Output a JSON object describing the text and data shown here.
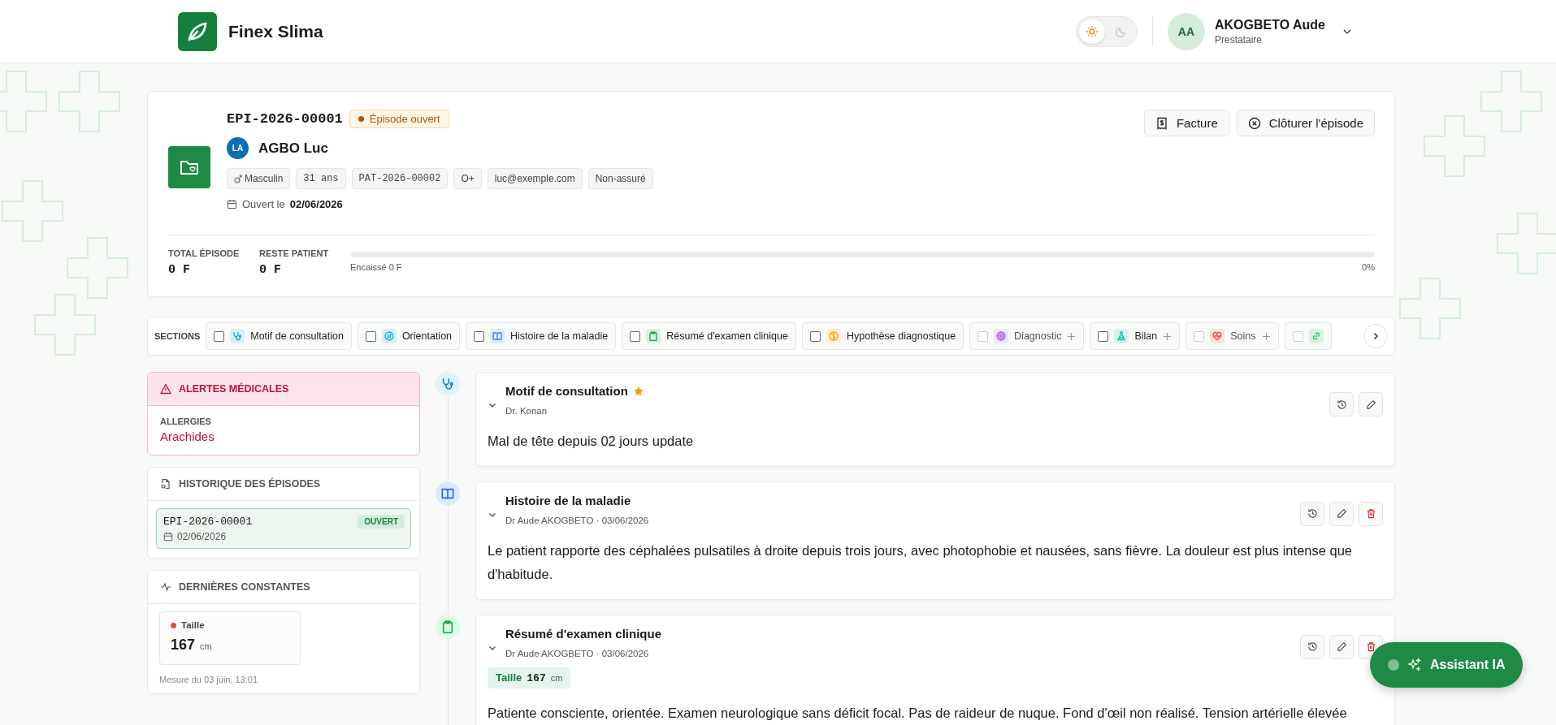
{
  "header": {
    "app_name": "Finex Slima",
    "theme_toggle": [
      {
        "kind": "sun",
        "selected": true
      },
      {
        "kind": "moon",
        "selected": false
      }
    ],
    "user": {
      "initials": "AA",
      "name": "AKOGBETO Aude",
      "role": "Prestataire"
    }
  },
  "episode": {
    "code": "EPI-2026-00001",
    "status": "Épisode ouvert",
    "patient": {
      "initials": "LA",
      "name": "AGBO Luc"
    },
    "tags": [
      {
        "kind": "gender",
        "label": "Masculin"
      },
      {
        "kind": "mono",
        "label": "31 ans"
      },
      {
        "kind": "mono",
        "label": "PAT-2026-00002"
      },
      {
        "kind": "text",
        "label": "O+"
      },
      {
        "kind": "text",
        "label": "luc@exemple.com"
      },
      {
        "kind": "text",
        "label": "Non-assuré"
      }
    ],
    "opened_label": "Ouvert le",
    "opened_date": "02/06/2026",
    "actions": [
      {
        "kind": "invoice",
        "label": "Facture"
      },
      {
        "kind": "close",
        "label": "Clôturer l'épisode"
      }
    ],
    "totals": [
      {
        "label": "TOTAL ÉPISODE",
        "value": "0 F"
      },
      {
        "label": "RESTE PATIENT",
        "value": "0 F"
      }
    ],
    "progress": {
      "caption": "Encaissé 0 F",
      "percent": "0%",
      "level": 0
    }
  },
  "sections": {
    "label": "SECTIONS",
    "items": [
      {
        "kind": "stethoscope",
        "label": "Motif de consultation",
        "color": "#0ea5e9",
        "checked": false,
        "disabled": false,
        "addable": false
      },
      {
        "kind": "compass",
        "label": "Orientation",
        "color": "#06b6d4",
        "checked": false,
        "disabled": false,
        "addable": false
      },
      {
        "kind": "book",
        "label": "Histoire de la maladie",
        "color": "#3b82f6",
        "checked": false,
        "disabled": false,
        "addable": false
      },
      {
        "kind": "clipboard",
        "label": "Résumé d'examen clinique",
        "color": "#16a34a",
        "checked": false,
        "disabled": false,
        "addable": false
      },
      {
        "kind": "brain",
        "label": "Hypothèse diagnostique",
        "color": "#f59e0b",
        "checked": false,
        "disabled": false,
        "addable": false
      },
      {
        "kind": "target",
        "label": "Diagnostic",
        "color": "#a855f7",
        "checked": false,
        "disabled": true,
        "addable": true
      },
      {
        "kind": "flask",
        "label": "Bilan",
        "color": "#14b8a6",
        "checked": false,
        "disabled": false,
        "addable": true
      },
      {
        "kind": "heart",
        "label": "Soins",
        "color": "#ef4444",
        "checked": false,
        "disabled": true,
        "addable": true
      },
      {
        "kind": "link",
        "color": "#22c55e",
        "checked": false,
        "disabled": true,
        "addable": false
      }
    ]
  },
  "alerts": {
    "title": "ALERTES MÉDICALES",
    "label": "ALLERGIES",
    "value": "Arachides"
  },
  "history": {
    "title": "HISTORIQUE DES ÉPISODES",
    "items": [
      {
        "code": "EPI-2026-00001",
        "status": "OUVERT",
        "date": "02/06/2026",
        "selected": true
      }
    ]
  },
  "vitals": {
    "title": "DERNIÈRES CONSTANTES",
    "items": [
      {
        "label": "Taille",
        "value": "167",
        "unit": "cm",
        "color": "#dc4c3e"
      }
    ],
    "footnote": "Mesure du 03 juin, 13:01"
  },
  "entries": [
    {
      "kind": "stethoscope",
      "title": "Motif de consultation",
      "starred": true,
      "author": "Dr. Konan",
      "deletable": false,
      "text": "Mal de tête depuis 02 jours update"
    },
    {
      "kind": "book",
      "title": "Histoire de la maladie",
      "starred": false,
      "author": "Dr Aude AKOGBETO · 03/06/2026",
      "deletable": true,
      "text": "Le patient rapporte des céphalées pulsatiles à droite depuis trois jours, avec photophobie et nausées, sans fièvre. La douleur est plus intense que d'habitude."
    },
    {
      "kind": "clipboard",
      "title": "Résumé d'examen clinique",
      "starred": false,
      "author": "Dr Aude AKOGBETO · 03/06/2026",
      "deletable": true,
      "measure": {
        "label": "Taille",
        "value": "167",
        "unit": "cm"
      },
      "text": "Patiente consciente, orientée. Examen neurologique sans déficit focal. Pas de raideur de nuque. Fond d'œil non réalisé. Tension artérielle élevée"
    }
  ],
  "assistant": {
    "label": "Assistant IA"
  }
}
